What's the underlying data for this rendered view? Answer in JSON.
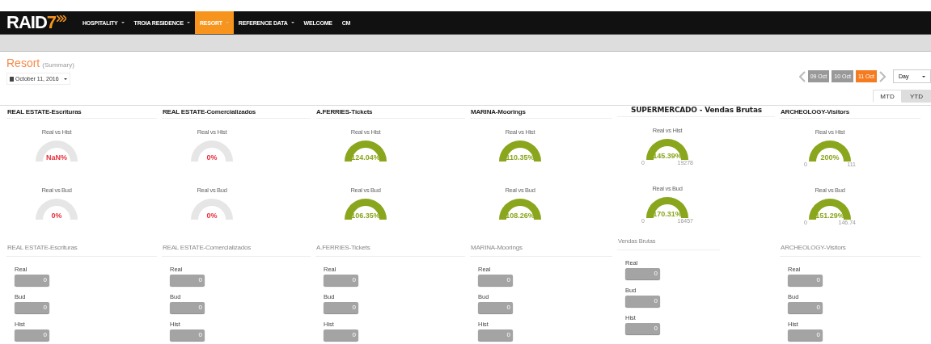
{
  "header": {
    "logo_text": "RAID",
    "logo_number": "7",
    "menu": [
      {
        "label": "HOSPITALITY",
        "dropdown": true,
        "selected": false
      },
      {
        "label": "TROIA RESIDENCE",
        "dropdown": true,
        "selected": false
      },
      {
        "label": "RESORT",
        "dropdown": true,
        "selected": true
      },
      {
        "label": "REFERENCE DATA",
        "dropdown": true,
        "selected": false
      },
      {
        "label": "WELCOME",
        "dropdown": false,
        "selected": false
      },
      {
        "label": "CM",
        "dropdown": false,
        "selected": false
      }
    ]
  },
  "page": {
    "title": "Resort",
    "subtitle": "(Summary)",
    "date": "October 11, 2016"
  },
  "date_nav": {
    "days": [
      {
        "label": "09 Oct",
        "selected": false
      },
      {
        "label": "10 Oct",
        "selected": false
      },
      {
        "label": "11 Oct",
        "selected": true
      }
    ],
    "period": "Day"
  },
  "tabs": [
    {
      "label": "MTD",
      "selected": true
    },
    {
      "label": "YTD",
      "selected": false
    }
  ],
  "panels": [
    {
      "title": "REAL ESTATE-Escrituras",
      "kind": "normal",
      "gauges": [
        {
          "label": "Real vs Hist",
          "value": "NaN%",
          "filled": false,
          "color": "#e8303a"
        },
        {
          "label": "Real vs Bud",
          "value": "0%",
          "filled": false,
          "color": "#e8303a"
        }
      ]
    },
    {
      "title": "REAL ESTATE-Comercializados",
      "kind": "normal",
      "gauges": [
        {
          "label": "Real vs Hist",
          "value": "0%",
          "filled": false,
          "color": "#e8303a"
        },
        {
          "label": "Real vs Bud",
          "value": "0%",
          "filled": false,
          "color": "#e8303a"
        }
      ]
    },
    {
      "title": "A.FERRIES-Tickets",
      "kind": "normal",
      "gauges": [
        {
          "label": "Real vs Hist",
          "value": "124.04%",
          "filled": true,
          "color": "#8aa61c"
        },
        {
          "label": "Real vs Bud",
          "value": "106.35%",
          "filled": true,
          "color": "#8aa61c"
        }
      ]
    },
    {
      "title": "MARINA-Moorings",
      "kind": "normal",
      "gauges": [
        {
          "label": "Real vs Hist",
          "value": "110.35%",
          "filled": true,
          "color": "#8aa61c"
        },
        {
          "label": "Real vs Bud",
          "value": "108.26%",
          "filled": true,
          "color": "#8aa61c"
        }
      ]
    },
    {
      "title": "SUPERMERCADO - Vendas Brutas",
      "kind": "large",
      "gauges": [
        {
          "label": "Real vs Hist",
          "value": "145.39%",
          "filled": true,
          "color": "#8aa61c",
          "min": "0",
          "max": "19278"
        },
        {
          "label": "Real vs Bud",
          "value": "170.31%",
          "filled": true,
          "color": "#8aa61c",
          "min": "0",
          "max": "16457"
        }
      ]
    },
    {
      "title": "ARCHEOLOGY-Visitors",
      "kind": "normal",
      "gauges": [
        {
          "label": "Real vs Hist",
          "value": "200%",
          "filled": true,
          "color": "#8aa61c",
          "min": "0",
          "max": "111"
        },
        {
          "label": "Real vs Bud",
          "value": "151.29%",
          "filled": true,
          "color": "#8aa61c",
          "min": "0",
          "max": "146.74"
        }
      ]
    }
  ],
  "value_panels": [
    {
      "title": "REAL ESTATE-Escrituras",
      "kind": "normal",
      "fields": [
        {
          "label": "Real",
          "value": "0"
        },
        {
          "label": "Bud",
          "value": "0"
        },
        {
          "label": "Hist",
          "value": "0"
        }
      ]
    },
    {
      "title": "REAL ESTATE-Comercializados",
      "kind": "normal",
      "fields": [
        {
          "label": "Real",
          "value": "0"
        },
        {
          "label": "Bud",
          "value": "0"
        },
        {
          "label": "Hist",
          "value": "0"
        }
      ]
    },
    {
      "title": "A.FERRIES-Tickets",
      "kind": "normal",
      "fields": [
        {
          "label": "Real",
          "value": "0"
        },
        {
          "label": "Bud",
          "value": "0"
        },
        {
          "label": "Hist",
          "value": "0"
        }
      ]
    },
    {
      "title": "MARINA-Moorings",
      "kind": "normal",
      "fields": [
        {
          "label": "Real",
          "value": "0"
        },
        {
          "label": "Bud",
          "value": "0"
        },
        {
          "label": "Hist",
          "value": "0"
        }
      ]
    },
    {
      "title": "Vendas Brutas",
      "kind": "small",
      "fields": [
        {
          "label": "Real",
          "value": "0"
        },
        {
          "label": "Bud",
          "value": "0"
        },
        {
          "label": "Hist",
          "value": "0"
        }
      ]
    },
    {
      "title": "ARCHEOLOGY-Visitors",
      "kind": "normal",
      "fields": [
        {
          "label": "Real",
          "value": "0"
        },
        {
          "label": "Bud",
          "value": "0"
        },
        {
          "label": "Hist",
          "value": "0"
        }
      ]
    }
  ]
}
